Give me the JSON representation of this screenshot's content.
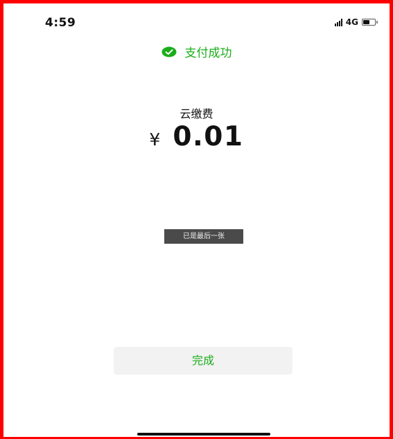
{
  "status_bar": {
    "time": "4:59",
    "network": "4G",
    "battery_fill": 0.5
  },
  "result": {
    "title": "支付成功",
    "icon": "check-icon",
    "accent_color": "#1aad19"
  },
  "payment": {
    "merchant": "云缴费",
    "currency_symbol": "¥",
    "amount": "0.01"
  },
  "toast": {
    "text": "已是最后一张"
  },
  "actions": {
    "done_label": "完成"
  }
}
